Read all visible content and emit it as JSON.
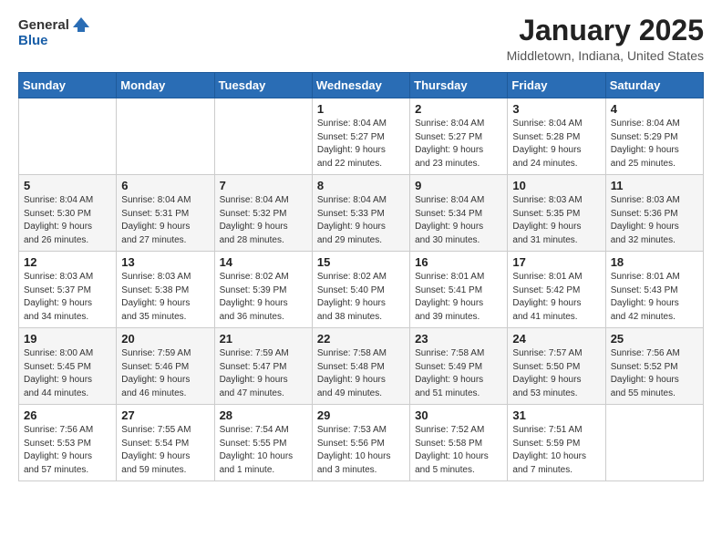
{
  "header": {
    "logo_line1": "General",
    "logo_line2": "Blue",
    "month": "January 2025",
    "location": "Middletown, Indiana, United States"
  },
  "weekdays": [
    "Sunday",
    "Monday",
    "Tuesday",
    "Wednesday",
    "Thursday",
    "Friday",
    "Saturday"
  ],
  "weeks": [
    [
      {
        "day": "",
        "info": ""
      },
      {
        "day": "",
        "info": ""
      },
      {
        "day": "",
        "info": ""
      },
      {
        "day": "1",
        "info": "Sunrise: 8:04 AM\nSunset: 5:27 PM\nDaylight: 9 hours\nand 22 minutes."
      },
      {
        "day": "2",
        "info": "Sunrise: 8:04 AM\nSunset: 5:27 PM\nDaylight: 9 hours\nand 23 minutes."
      },
      {
        "day": "3",
        "info": "Sunrise: 8:04 AM\nSunset: 5:28 PM\nDaylight: 9 hours\nand 24 minutes."
      },
      {
        "day": "4",
        "info": "Sunrise: 8:04 AM\nSunset: 5:29 PM\nDaylight: 9 hours\nand 25 minutes."
      }
    ],
    [
      {
        "day": "5",
        "info": "Sunrise: 8:04 AM\nSunset: 5:30 PM\nDaylight: 9 hours\nand 26 minutes."
      },
      {
        "day": "6",
        "info": "Sunrise: 8:04 AM\nSunset: 5:31 PM\nDaylight: 9 hours\nand 27 minutes."
      },
      {
        "day": "7",
        "info": "Sunrise: 8:04 AM\nSunset: 5:32 PM\nDaylight: 9 hours\nand 28 minutes."
      },
      {
        "day": "8",
        "info": "Sunrise: 8:04 AM\nSunset: 5:33 PM\nDaylight: 9 hours\nand 29 minutes."
      },
      {
        "day": "9",
        "info": "Sunrise: 8:04 AM\nSunset: 5:34 PM\nDaylight: 9 hours\nand 30 minutes."
      },
      {
        "day": "10",
        "info": "Sunrise: 8:03 AM\nSunset: 5:35 PM\nDaylight: 9 hours\nand 31 minutes."
      },
      {
        "day": "11",
        "info": "Sunrise: 8:03 AM\nSunset: 5:36 PM\nDaylight: 9 hours\nand 32 minutes."
      }
    ],
    [
      {
        "day": "12",
        "info": "Sunrise: 8:03 AM\nSunset: 5:37 PM\nDaylight: 9 hours\nand 34 minutes."
      },
      {
        "day": "13",
        "info": "Sunrise: 8:03 AM\nSunset: 5:38 PM\nDaylight: 9 hours\nand 35 minutes."
      },
      {
        "day": "14",
        "info": "Sunrise: 8:02 AM\nSunset: 5:39 PM\nDaylight: 9 hours\nand 36 minutes."
      },
      {
        "day": "15",
        "info": "Sunrise: 8:02 AM\nSunset: 5:40 PM\nDaylight: 9 hours\nand 38 minutes."
      },
      {
        "day": "16",
        "info": "Sunrise: 8:01 AM\nSunset: 5:41 PM\nDaylight: 9 hours\nand 39 minutes."
      },
      {
        "day": "17",
        "info": "Sunrise: 8:01 AM\nSunset: 5:42 PM\nDaylight: 9 hours\nand 41 minutes."
      },
      {
        "day": "18",
        "info": "Sunrise: 8:01 AM\nSunset: 5:43 PM\nDaylight: 9 hours\nand 42 minutes."
      }
    ],
    [
      {
        "day": "19",
        "info": "Sunrise: 8:00 AM\nSunset: 5:45 PM\nDaylight: 9 hours\nand 44 minutes."
      },
      {
        "day": "20",
        "info": "Sunrise: 7:59 AM\nSunset: 5:46 PM\nDaylight: 9 hours\nand 46 minutes."
      },
      {
        "day": "21",
        "info": "Sunrise: 7:59 AM\nSunset: 5:47 PM\nDaylight: 9 hours\nand 47 minutes."
      },
      {
        "day": "22",
        "info": "Sunrise: 7:58 AM\nSunset: 5:48 PM\nDaylight: 9 hours\nand 49 minutes."
      },
      {
        "day": "23",
        "info": "Sunrise: 7:58 AM\nSunset: 5:49 PM\nDaylight: 9 hours\nand 51 minutes."
      },
      {
        "day": "24",
        "info": "Sunrise: 7:57 AM\nSunset: 5:50 PM\nDaylight: 9 hours\nand 53 minutes."
      },
      {
        "day": "25",
        "info": "Sunrise: 7:56 AM\nSunset: 5:52 PM\nDaylight: 9 hours\nand 55 minutes."
      }
    ],
    [
      {
        "day": "26",
        "info": "Sunrise: 7:56 AM\nSunset: 5:53 PM\nDaylight: 9 hours\nand 57 minutes."
      },
      {
        "day": "27",
        "info": "Sunrise: 7:55 AM\nSunset: 5:54 PM\nDaylight: 9 hours\nand 59 minutes."
      },
      {
        "day": "28",
        "info": "Sunrise: 7:54 AM\nSunset: 5:55 PM\nDaylight: 10 hours\nand 1 minute."
      },
      {
        "day": "29",
        "info": "Sunrise: 7:53 AM\nSunset: 5:56 PM\nDaylight: 10 hours\nand 3 minutes."
      },
      {
        "day": "30",
        "info": "Sunrise: 7:52 AM\nSunset: 5:58 PM\nDaylight: 10 hours\nand 5 minutes."
      },
      {
        "day": "31",
        "info": "Sunrise: 7:51 AM\nSunset: 5:59 PM\nDaylight: 10 hours\nand 7 minutes."
      },
      {
        "day": "",
        "info": ""
      }
    ]
  ]
}
